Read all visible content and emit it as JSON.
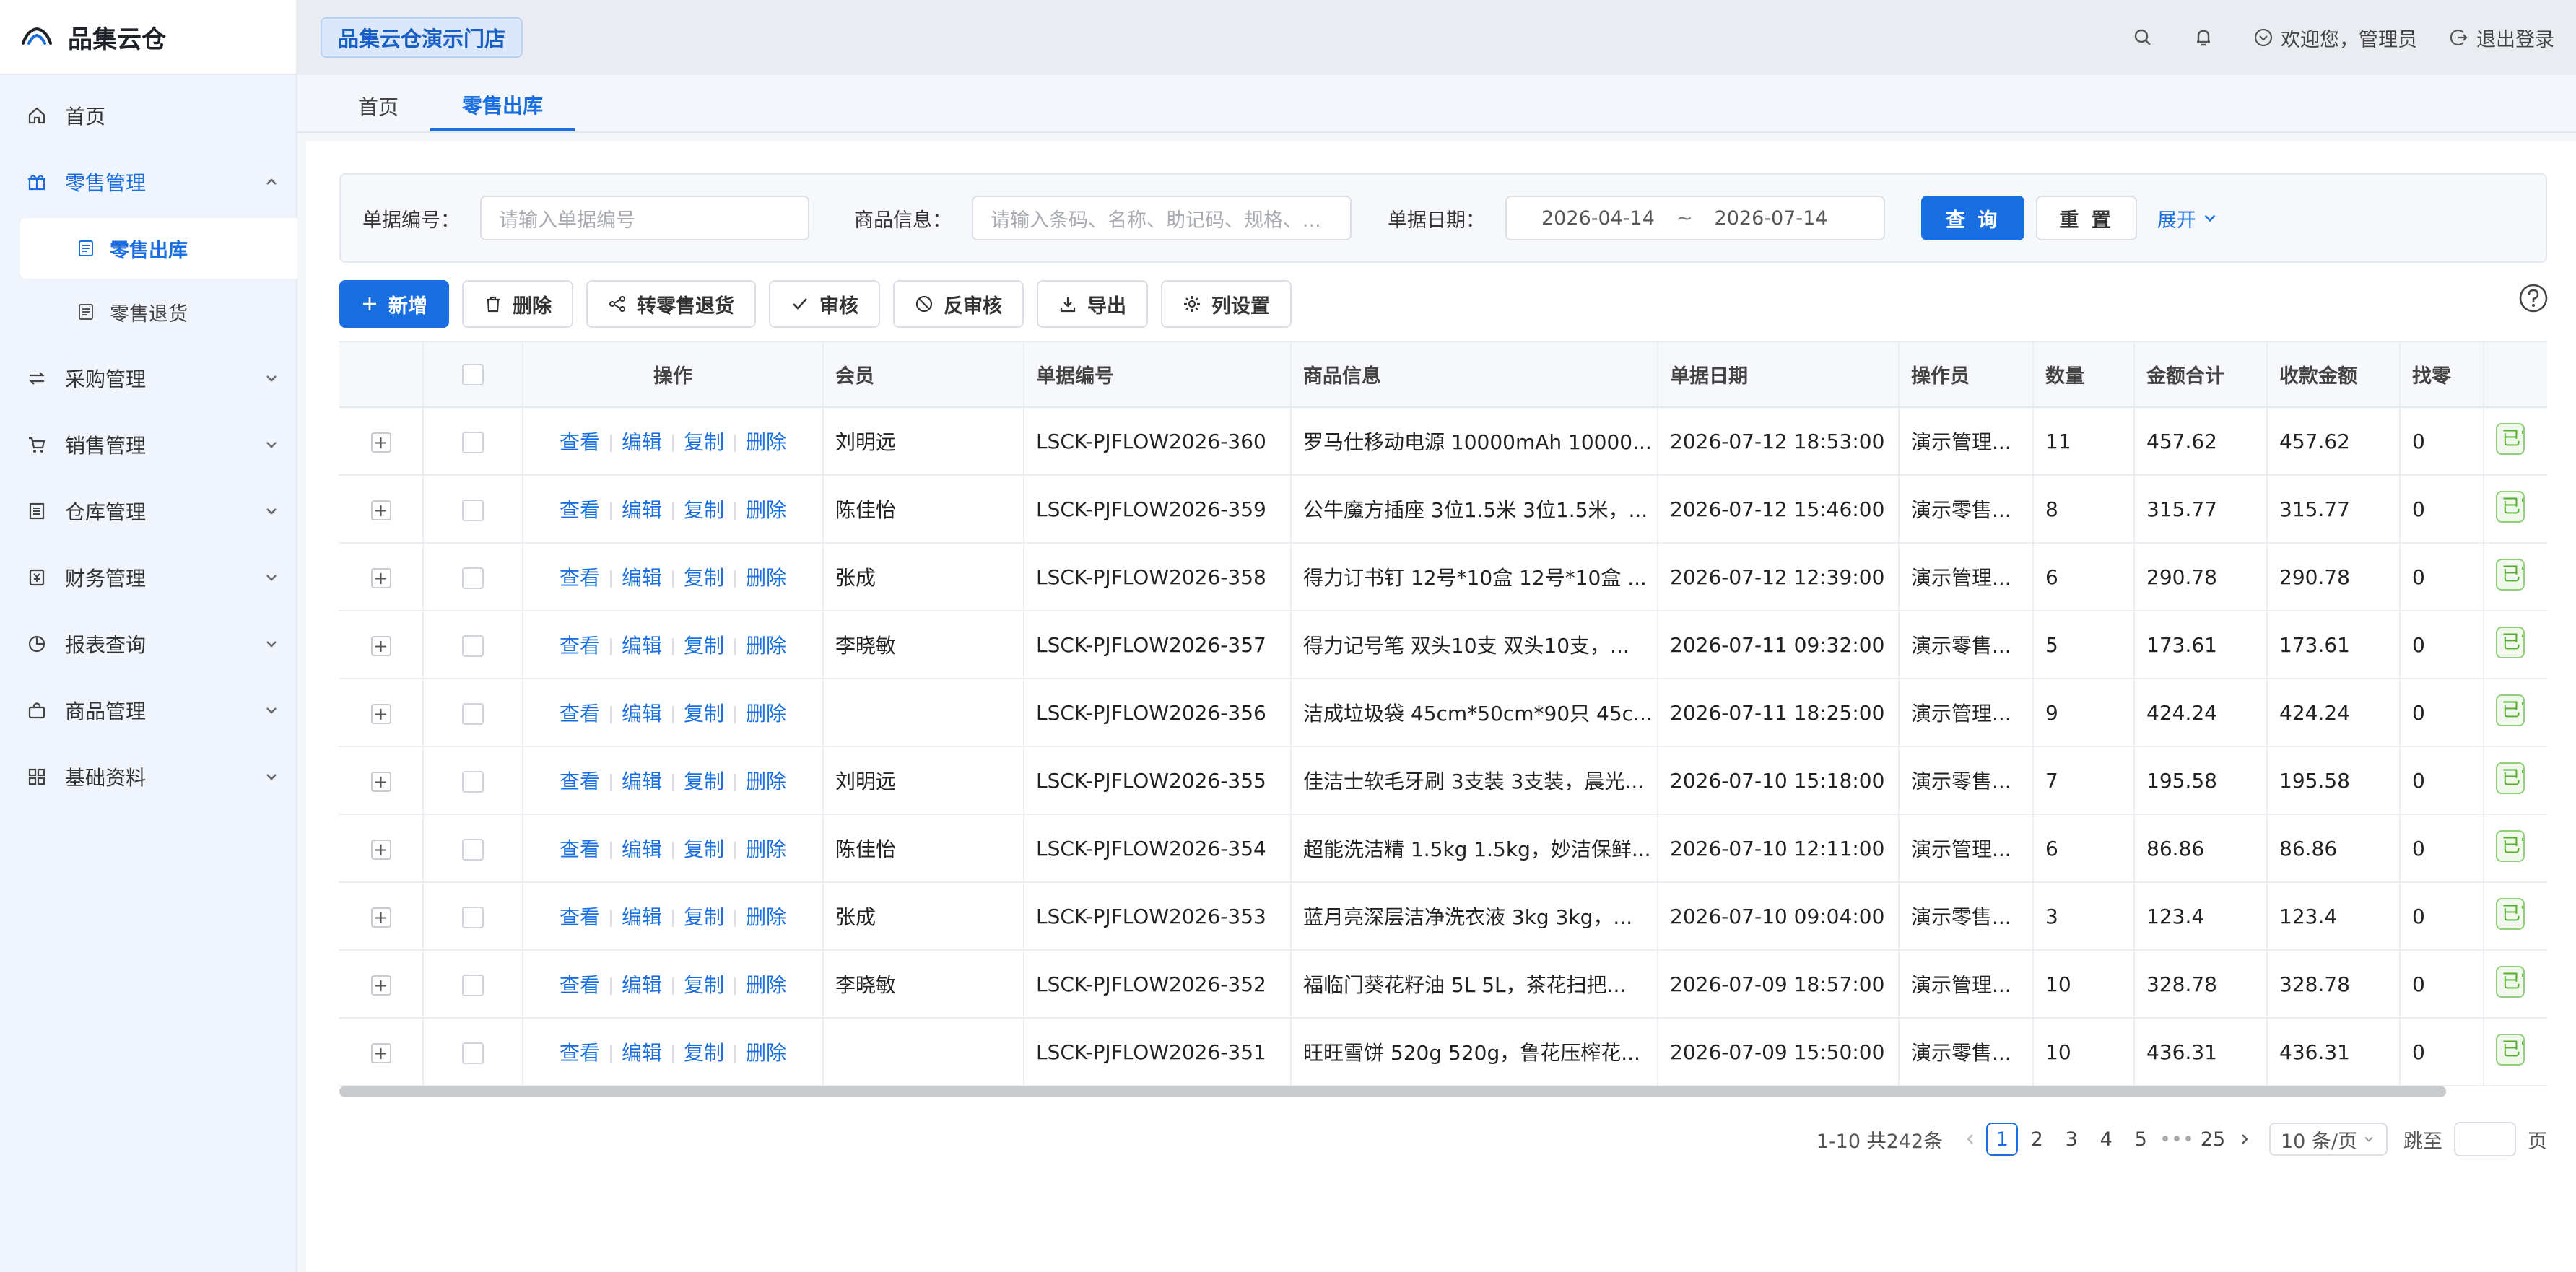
{
  "app": {
    "name": "品集云仓",
    "store": "品集云仓演示门店"
  },
  "sidebar": {
    "items": [
      {
        "label": "首页"
      },
      {
        "label": "零售管理"
      },
      {
        "label": "零售出库"
      },
      {
        "label": "零售退货"
      },
      {
        "label": "采购管理"
      },
      {
        "label": "销售管理"
      },
      {
        "label": "仓库管理"
      },
      {
        "label": "财务管理"
      },
      {
        "label": "报表查询"
      },
      {
        "label": "商品管理"
      },
      {
        "label": "基础资料"
      }
    ]
  },
  "header": {
    "welcome": "欢迎您，管理员",
    "logout": "退出登录"
  },
  "tabs": [
    {
      "label": "首页"
    },
    {
      "label": "零售出库"
    }
  ],
  "search": {
    "doc_no_label": "单据编号：",
    "doc_no_placeholder": "请输入单据编号",
    "product_label": "商品信息：",
    "product_placeholder": "请输入条码、名称、助记码、规格、...",
    "date_label": "单据日期：",
    "date_start": "2026-04-14",
    "date_sep": "~",
    "date_end": "2026-07-14",
    "query": "查 询",
    "reset": "重 置",
    "expand": "展开"
  },
  "toolbar": {
    "add": "新增",
    "delete": "删除",
    "to_return": "转零售退货",
    "audit": "审核",
    "unaudit": "反审核",
    "export": "导出",
    "columns": "列设置"
  },
  "table": {
    "columns": [
      "操作",
      "会员",
      "单据编号",
      "商品信息",
      "单据日期",
      "操作员",
      "数量",
      "金额合计",
      "收款金额",
      "找零"
    ],
    "ops": [
      "查看",
      "编辑",
      "复制",
      "删除"
    ],
    "expand_symbol": "+",
    "status_text": "已审核",
    "rows": [
      {
        "member": "刘明远",
        "no": "LSCK-PJFLOW2026-360",
        "product": "罗马仕移动电源 10000mAh 10000...",
        "date": "2026-07-12 18:53:00",
        "operator": "演示管理...",
        "qty": "11",
        "total": "457.62",
        "received": "457.62",
        "change": "0"
      },
      {
        "member": "陈佳怡",
        "no": "LSCK-PJFLOW2026-359",
        "product": "公牛魔方插座 3位1.5米 3位1.5米，...",
        "date": "2026-07-12 15:46:00",
        "operator": "演示零售...",
        "qty": "8",
        "total": "315.77",
        "received": "315.77",
        "change": "0"
      },
      {
        "member": "张成",
        "no": "LSCK-PJFLOW2026-358",
        "product": "得力订书钉 12号*10盒 12号*10盒 ...",
        "date": "2026-07-12 12:39:00",
        "operator": "演示管理...",
        "qty": "6",
        "total": "290.78",
        "received": "290.78",
        "change": "0"
      },
      {
        "member": "李晓敏",
        "no": "LSCK-PJFLOW2026-357",
        "product": "得力记号笔 双头10支 双头10支，...",
        "date": "2026-07-11 09:32:00",
        "operator": "演示零售...",
        "qty": "5",
        "total": "173.61",
        "received": "173.61",
        "change": "0"
      },
      {
        "member": "",
        "no": "LSCK-PJFLOW2026-356",
        "product": "洁成垃圾袋 45cm*50cm*90只 45c...",
        "date": "2026-07-11 18:25:00",
        "operator": "演示管理...",
        "qty": "9",
        "total": "424.24",
        "received": "424.24",
        "change": "0"
      },
      {
        "member": "刘明远",
        "no": "LSCK-PJFLOW2026-355",
        "product": "佳洁士软毛牙刷 3支装 3支装，晨光...",
        "date": "2026-07-10 15:18:00",
        "operator": "演示零售...",
        "qty": "7",
        "total": "195.58",
        "received": "195.58",
        "change": "0"
      },
      {
        "member": "陈佳怡",
        "no": "LSCK-PJFLOW2026-354",
        "product": "超能洗洁精 1.5kg 1.5kg，妙洁保鲜...",
        "date": "2026-07-10 12:11:00",
        "operator": "演示管理...",
        "qty": "6",
        "total": "86.86",
        "received": "86.86",
        "change": "0"
      },
      {
        "member": "张成",
        "no": "LSCK-PJFLOW2026-353",
        "product": "蓝月亮深层洁净洗衣液 3kg 3kg，...",
        "date": "2026-07-10 09:04:00",
        "operator": "演示零售...",
        "qty": "3",
        "total": "123.4",
        "received": "123.4",
        "change": "0"
      },
      {
        "member": "李晓敏",
        "no": "LSCK-PJFLOW2026-352",
        "product": "福临门葵花籽油 5L 5L，茶花扫把...",
        "date": "2026-07-09 18:57:00",
        "operator": "演示管理...",
        "qty": "10",
        "total": "328.78",
        "received": "328.78",
        "change": "0"
      },
      {
        "member": "",
        "no": "LSCK-PJFLOW2026-351",
        "product": "旺旺雪饼 520g 520g，鲁花压榨花...",
        "date": "2026-07-09 15:50:00",
        "operator": "演示零售...",
        "qty": "10",
        "total": "436.31",
        "received": "436.31",
        "change": "0"
      }
    ]
  },
  "pagination": {
    "summary": "1-10 共242条",
    "pages": [
      "1",
      "2",
      "3",
      "4",
      "5",
      "•••",
      "25"
    ],
    "page_size": "10 条/页",
    "jump_label": "跳至",
    "page_suffix": "页"
  },
  "colors": {
    "primary": "#1a6fe0",
    "success": "#52b02a"
  }
}
